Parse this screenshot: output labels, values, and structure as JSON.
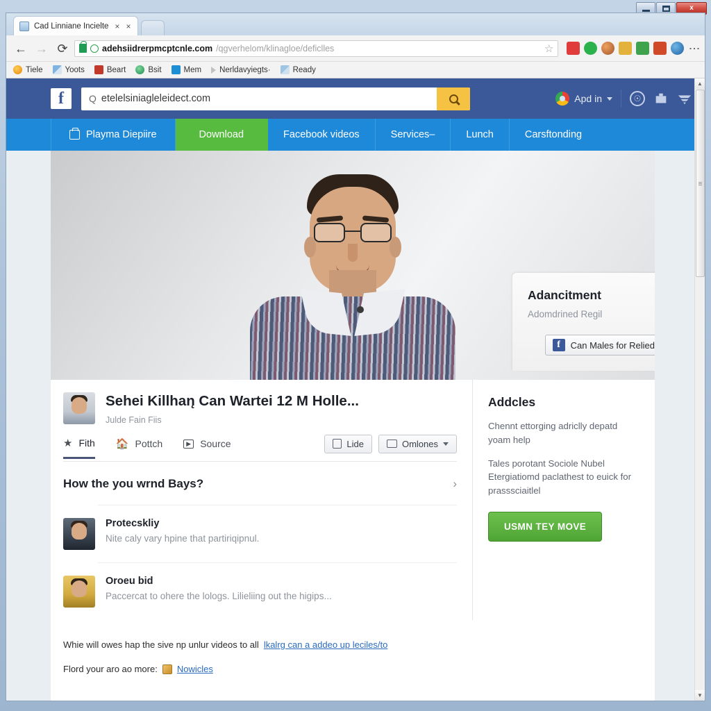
{
  "window": {
    "minimize_label": "Minimize",
    "maximize_label": "Maximize",
    "close_label": "x"
  },
  "browser": {
    "tab": {
      "title": "Cad Linniane Incielte",
      "close_label": "×",
      "extra_close_label": "×",
      "favicon": "page-favicon",
      "new_tab_label": ""
    },
    "toolbar": {
      "back_label": "←",
      "forward_label": "→",
      "reload_label": "⟳",
      "star_label": "☆",
      "menu_label": "⋮"
    },
    "omnibox": {
      "url_strong": "adehsiidrerpmcptcnle.com",
      "url_dim": "/qgverhelom/klinagloe/deficlles",
      "lock_icon": "lock-icon",
      "info_icon": "page-info-icon"
    },
    "extensions": [
      "ext-red",
      "ext-green",
      "ext-orange",
      "ext-yellow",
      "ext-green2",
      "ext-red2",
      "ext-blue"
    ],
    "bookmarks": [
      {
        "label": "Tiele",
        "icon": "bookmark-icon-orange"
      },
      {
        "label": "Yoots",
        "icon": "bookmark-icon-grid"
      },
      {
        "label": "Beart",
        "icon": "bookmark-icon-red"
      },
      {
        "label": "Bsit",
        "icon": "bookmark-icon-green"
      },
      {
        "label": "Mem",
        "icon": "bookmark-icon-blue"
      },
      {
        "label": "Nerldavyiegts·",
        "icon": "folder-arrow-icon"
      },
      {
        "label": "Ready",
        "icon": "bookmark-icon-mosaic"
      }
    ]
  },
  "fb_header": {
    "logo": "f",
    "search_prefix": "Q",
    "search_value": "etelelsiniagleleidect.com",
    "search_placeholder": "Search",
    "search_button": "search-icon",
    "account_label": "Apd in",
    "icons": [
      "profile-icon",
      "messages-icon",
      "notifications-icon"
    ]
  },
  "fb_nav": {
    "items": [
      {
        "label": "Playma Diepiire",
        "icon": "lock-home-icon",
        "active": false
      },
      {
        "label": "Download",
        "active": true
      },
      {
        "label": "Facebook videos",
        "active": false
      },
      {
        "label": "Services–",
        "active": false
      },
      {
        "label": "Lunch",
        "active": false
      },
      {
        "label": "Carsftonding",
        "active": false
      }
    ]
  },
  "ad_panel": {
    "title": "Adancitment",
    "subtitle": "Adomdrined Regil",
    "cta_label": "Can Males for Relied",
    "caret": "chevron-down-icon"
  },
  "video": {
    "title": "Sehei Killhan̨ Can Wartei 12 M Holle...",
    "subtitle": "Julde Fain Fiis",
    "avatar": "channel-avatar"
  },
  "actions": {
    "tabs": [
      {
        "label": "Fith",
        "icon": "star-icon",
        "active": true
      },
      {
        "label": "Pottch",
        "icon": "home-icon",
        "active": false
      },
      {
        "label": "Source",
        "icon": "source-icon",
        "active": false
      }
    ],
    "buttons": [
      {
        "label": "Lide",
        "icon": "device-icon"
      },
      {
        "label": "Omlones",
        "icon": "monitor-icon",
        "caret": true
      }
    ]
  },
  "question": {
    "text": "How the you wrnd Bays?",
    "chevron": "›"
  },
  "feed": [
    {
      "name": "Protecskliy",
      "desc": "Nite caly vary hpine that partiriqipnul.",
      "avatar": "feed-avatar-1"
    },
    {
      "name": "Oroeu bid",
      "desc": "Paccercat to ohere the lologs. Lilieliing out the higips...",
      "avatar": "feed-avatar-2"
    }
  ],
  "sidebar": {
    "title": "Addcles",
    "paragraph1": "Chennt ettorging adriclly depatd yoam help",
    "paragraph2": "Tales porotant Sociole Nubel Etergiatiomd paclathest to euick for prasssciaitlel",
    "cta_label": "USMN TEY MOVE"
  },
  "footer": {
    "line1_before": "Whie will owes hap the sive np unlur videos to all",
    "line1_link": "lkalrg can a addeo up leciles/to",
    "line2_before": "Flord your aro ao more:",
    "line2_link": "Nowicles",
    "line2_icon": "page-icon"
  },
  "scrollbar": {
    "up_arrow": "▲",
    "down_arrow": "▼"
  },
  "colors": {
    "fb_blue": "#3b5998",
    "nav_blue": "#1e88d9",
    "active_green": "#57bb3f",
    "search_yellow": "#f5c243",
    "cta_green": "#4fa534",
    "link_blue": "#2a6bbf"
  }
}
